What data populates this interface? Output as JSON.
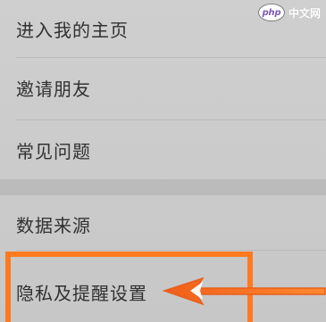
{
  "watermark": {
    "badge": "php",
    "text": "中文网"
  },
  "menu": {
    "items": [
      {
        "label": "进入我的主页"
      },
      {
        "label": "邀请朋友"
      },
      {
        "label": "常见问题"
      },
      {
        "label": "数据来源"
      },
      {
        "label": "隐私及提醒设置"
      }
    ]
  },
  "colors": {
    "highlight": "#ff7a1f",
    "background": "#cfcfcf"
  },
  "icons": {
    "arrow": "left-arrow-icon"
  }
}
